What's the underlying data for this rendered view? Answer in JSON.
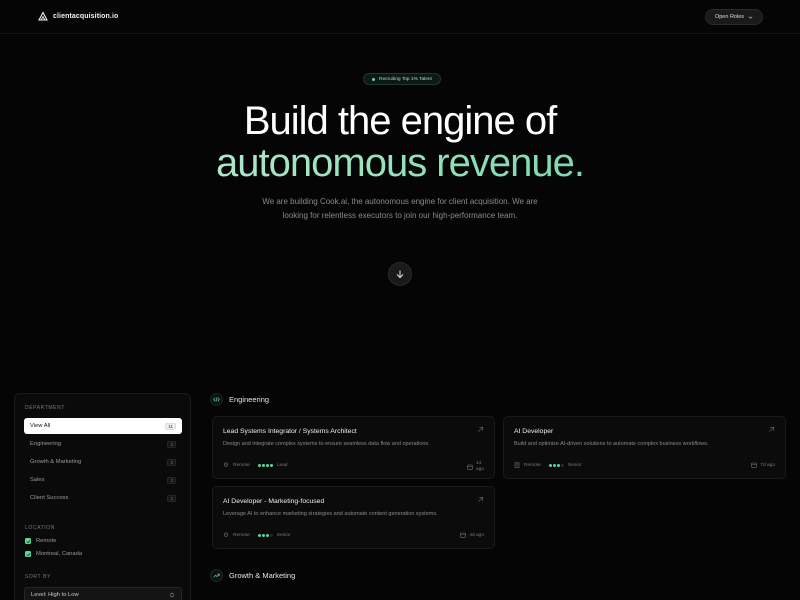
{
  "header": {
    "logo_text": "clientacquisition.io",
    "open_roles_label": "Open Roles",
    "open_roles_icon": "chevron-down-icon"
  },
  "hero": {
    "badge": "Recruiting Top 1% Talent",
    "title_line1": "Build the engine of",
    "title_line2": "autonomous revenue.",
    "subtitle": "We are building Cook.ai, the autonomous engine for client acquisition. We are looking for relentless executors to join our high-performance team.",
    "scroll_icon": "arrow-down-icon"
  },
  "sidebar": {
    "department_label": "DEPARTMENT",
    "departments": [
      {
        "label": "View All",
        "count": "11"
      },
      {
        "label": "Engineering",
        "count": "3"
      },
      {
        "label": "Growth & Marketing",
        "count": "3"
      },
      {
        "label": "Sales",
        "count": "3"
      },
      {
        "label": "Client Success",
        "count": "2"
      }
    ],
    "location_label": "LOCATION",
    "locations": [
      {
        "label": "Remote"
      },
      {
        "label": "Montreal, Canada"
      }
    ],
    "sort_label": "SORT BY",
    "sort_value": "Level: High to Low"
  },
  "sections": [
    {
      "title": "Engineering",
      "icon": "code-icon"
    },
    {
      "title": "Growth & Marketing",
      "icon": "trending-up-icon"
    }
  ],
  "jobs": [
    {
      "title": "Lead Systems Integrator / Systems Architect",
      "description": "Design and integrate complex systems to ensure seamless data flow and operations.",
      "location": "Remote",
      "level": "Lead",
      "level_dots": 4,
      "age_line1": "14",
      "age_line2": "ago"
    },
    {
      "title": "AI Developer",
      "description": "Build and optimize AI-driven solutions to automate complex business workflows.",
      "location": "Remote",
      "level": "Senior",
      "level_dots": 3,
      "age": "7d ago"
    },
    {
      "title": "AI Developer - Marketing-focused",
      "description": "Leverage AI to enhance marketing strategies and automate content generation systems.",
      "location": "Remote",
      "level": "Senior",
      "level_dots": 3,
      "age": "4d ago"
    }
  ],
  "colors": {
    "accent": "#5fd4a0",
    "background": "#050505",
    "card": "#0b0b0b"
  }
}
